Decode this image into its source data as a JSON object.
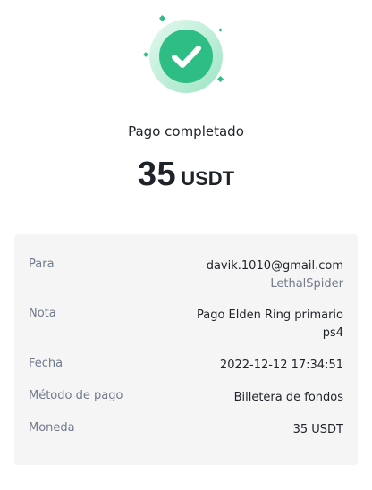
{
  "status": {
    "title": "Pago completado",
    "icon": "check-circle-icon",
    "accent_color": "#2ebd85"
  },
  "amount": {
    "value": "35",
    "unit": "USDT"
  },
  "details": {
    "rows": [
      {
        "label": "Para",
        "value": "davik.1010@gmail.com",
        "sub_value": "LethalSpider"
      },
      {
        "label": "Nota",
        "value": "Pago Elden Ring primario",
        "value_line2": "ps4"
      },
      {
        "label": "Fecha",
        "value": "2022-12-12 17:34:51"
      },
      {
        "label": "Método de pago",
        "value": "Billetera de fondos"
      },
      {
        "label": "Moneda",
        "value": "35 USDT"
      }
    ]
  }
}
